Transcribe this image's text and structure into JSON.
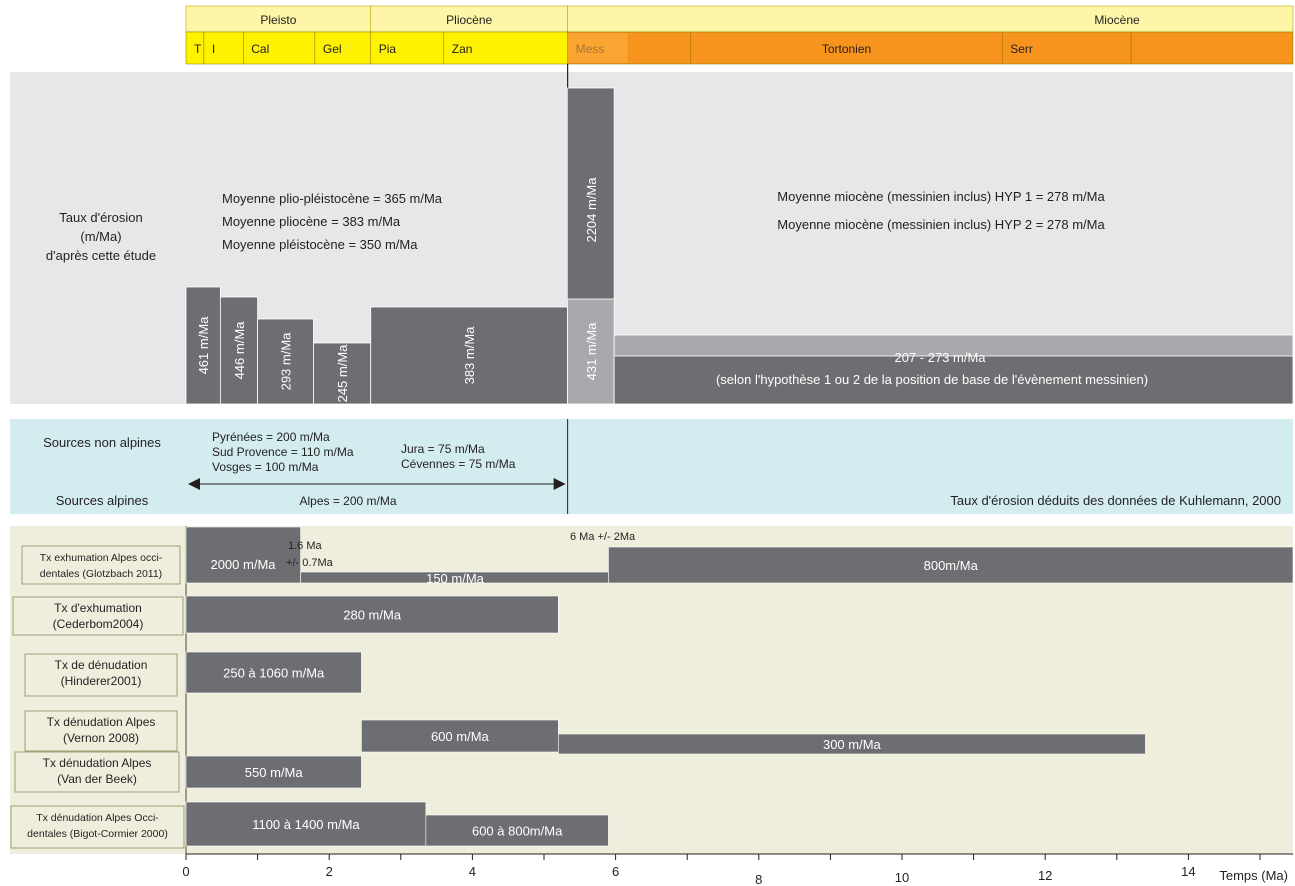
{
  "chart_data": {
    "type": "bar",
    "xlabel": "Temps (Ma)",
    "xlim": [
      0,
      15.5
    ],
    "x_ticks": [
      "0",
      "2",
      "4",
      "6",
      "8",
      "10",
      "12",
      "14"
    ],
    "x_tick_values": [
      0,
      2,
      4,
      6,
      8,
      10,
      12,
      14
    ],
    "colors": {
      "bar": "#6d6e71",
      "bar_light": "#a7a9ac",
      "erosion_panel": "#e6e7e8",
      "sources_panel": "#d3ecf0",
      "literature_panel": "#efeedd",
      "epoch_header": "#fdf6a8",
      "stage_yellow": "#fff200",
      "stage_orange": "#f7941d"
    },
    "epochs": [
      {
        "label": "Pleisto",
        "start": 0,
        "end": 2.58
      },
      {
        "label": "Pliocène",
        "start": 2.58,
        "end": 5.33
      },
      {
        "label": "Miocène",
        "start": 5.33,
        "end": 15.5
      }
    ],
    "stages": [
      {
        "label": "T",
        "start": 0,
        "end": 0.25,
        "color": "stage_yellow"
      },
      {
        "label": "I",
        "start": 0.25,
        "end": 0.8,
        "color": "stage_yellow"
      },
      {
        "label": "Cal",
        "start": 0.8,
        "end": 1.8,
        "color": "stage_yellow"
      },
      {
        "label": "Gel",
        "start": 1.8,
        "end": 2.58,
        "color": "stage_yellow"
      },
      {
        "label": "Pia",
        "start": 2.58,
        "end": 3.6,
        "color": "stage_yellow"
      },
      {
        "label": "Zan",
        "start": 3.6,
        "end": 5.33,
        "color": "stage_yellow"
      },
      {
        "label": "Mess",
        "start": 5.33,
        "end": 7.05,
        "color": "stage_orange"
      },
      {
        "label": "Tortonien",
        "start": 7.05,
        "end": 11.4,
        "color": "stage_orange"
      },
      {
        "label": "Serr",
        "start": 11.4,
        "end": 13.2,
        "color": "stage_orange"
      },
      {
        "label": "",
        "start": 13.2,
        "end": 15.5,
        "color": "stage_orange"
      }
    ],
    "erosion_panel": {
      "label": "Taux d'érosion\n(m/Ma)\nd'après cette étude",
      "ylim": [
        0,
        2500
      ],
      "bars": [
        {
          "start": 0,
          "end": 0.48,
          "value": 461,
          "label": "461 m/Ma",
          "tone": "bar"
        },
        {
          "start": 0.48,
          "end": 1.0,
          "value": 446,
          "label": "446 m/Ma",
          "tone": "bar"
        },
        {
          "start": 1.0,
          "end": 1.78,
          "value": 293,
          "label": "293 m/Ma",
          "tone": "bar"
        },
        {
          "start": 1.78,
          "end": 2.58,
          "value": 245,
          "label": "245 m/Ma",
          "tone": "bar"
        },
        {
          "start": 2.58,
          "end": 5.33,
          "value": 383,
          "label": "383 m/Ma",
          "tone": "bar"
        },
        {
          "start": 5.33,
          "end": 5.98,
          "value": 2204,
          "label": "2204 m/Ma",
          "tone": "bar"
        },
        {
          "start": 5.33,
          "end": 5.98,
          "value": 431,
          "label": "431 m/Ma",
          "tone": "bar_light"
        },
        {
          "start": 5.98,
          "end": 15.5,
          "value": 273,
          "label": "",
          "tone": "bar_light"
        },
        {
          "start": 5.98,
          "end": 15.5,
          "value": 207,
          "label": "",
          "tone": "bar"
        }
      ],
      "range_label": "207 - 273 m/Ma",
      "range_note": "(selon l'hypothèse 1 ou 2 de la position de base de l'évènement messinien)",
      "averages_left": [
        "Moyenne plio-pléistocène = 365 m/Ma",
        "Moyenne pliocène = 383 m/Ma",
        "Moyenne pléistocène = 350 m/Ma"
      ],
      "averages_right": [
        "Moyenne miocène (messinien inclus)  HYP 1 = 278 m/Ma",
        "Moyenne miocène (messinien inclus)  HYP 2 = 278 m/Ma"
      ]
    },
    "sources_panel": {
      "label_non_alpine": "Sources non alpines",
      "label_alpine": "Sources alpines",
      "non_alpine_left": [
        "Pyrénées = 200 m/Ma",
        "Sud Provence = 110 m/Ma",
        "Vosges = 100 m/Ma"
      ],
      "non_alpine_right": [
        "Jura = 75 m/Ma",
        "Cévennes = 75 m/Ma"
      ],
      "alpine": "Alpes = 200 m/Ma",
      "arrow_range": [
        0,
        5.33
      ],
      "footnote": "Taux d'érosion déduits des données de Kuhlemann, 2000"
    },
    "literature": [
      {
        "label": "Tx exhumation Alpes occi-\ndentales (Glotzbach 2011)",
        "bars": [
          {
            "start": 0,
            "end": 1.6,
            "value_label": "2000 m/Ma"
          },
          {
            "start": 1.6,
            "end": 5.9,
            "value_label": "150 m/Ma",
            "thin": true
          },
          {
            "start": 5.9,
            "end": 15.5,
            "value_label": "800m/Ma"
          }
        ],
        "annotations": [
          "1.6 Ma",
          "+/- 0.7Ma",
          "6 Ma +/- 2Ma"
        ]
      },
      {
        "label": "Tx d'exhumation\n(Cederbom2004)",
        "bars": [
          {
            "start": 0,
            "end": 5.2,
            "value_label": "280 m/Ma"
          }
        ]
      },
      {
        "label": "Tx de dénudation\n(Hinderer2001)",
        "bars": [
          {
            "start": 0,
            "end": 2.45,
            "value_label": "250 à 1060 m/Ma"
          }
        ]
      },
      {
        "label": "Tx dénudation Alpes\n(Vernon 2008)",
        "bars": [
          {
            "start": 2.45,
            "end": 5.2,
            "value_label": "600 m/Ma"
          },
          {
            "start": 5.2,
            "end": 13.4,
            "value_label": "300 m/Ma"
          }
        ]
      },
      {
        "label": "Tx dénudation Alpes\n(Van der Beek)",
        "bars": [
          {
            "start": 0,
            "end": 2.45,
            "value_label": "550 m/Ma"
          }
        ]
      },
      {
        "label": "Tx dénudation Alpes Occi-\ndentales (Bigot-Cormier 2000)",
        "bars": [
          {
            "start": 0,
            "end": 3.35,
            "value_label": "1100 à 1400 m/Ma"
          },
          {
            "start": 3.35,
            "end": 5.9,
            "value_label": "600 à 800m/Ma"
          }
        ]
      }
    ]
  }
}
